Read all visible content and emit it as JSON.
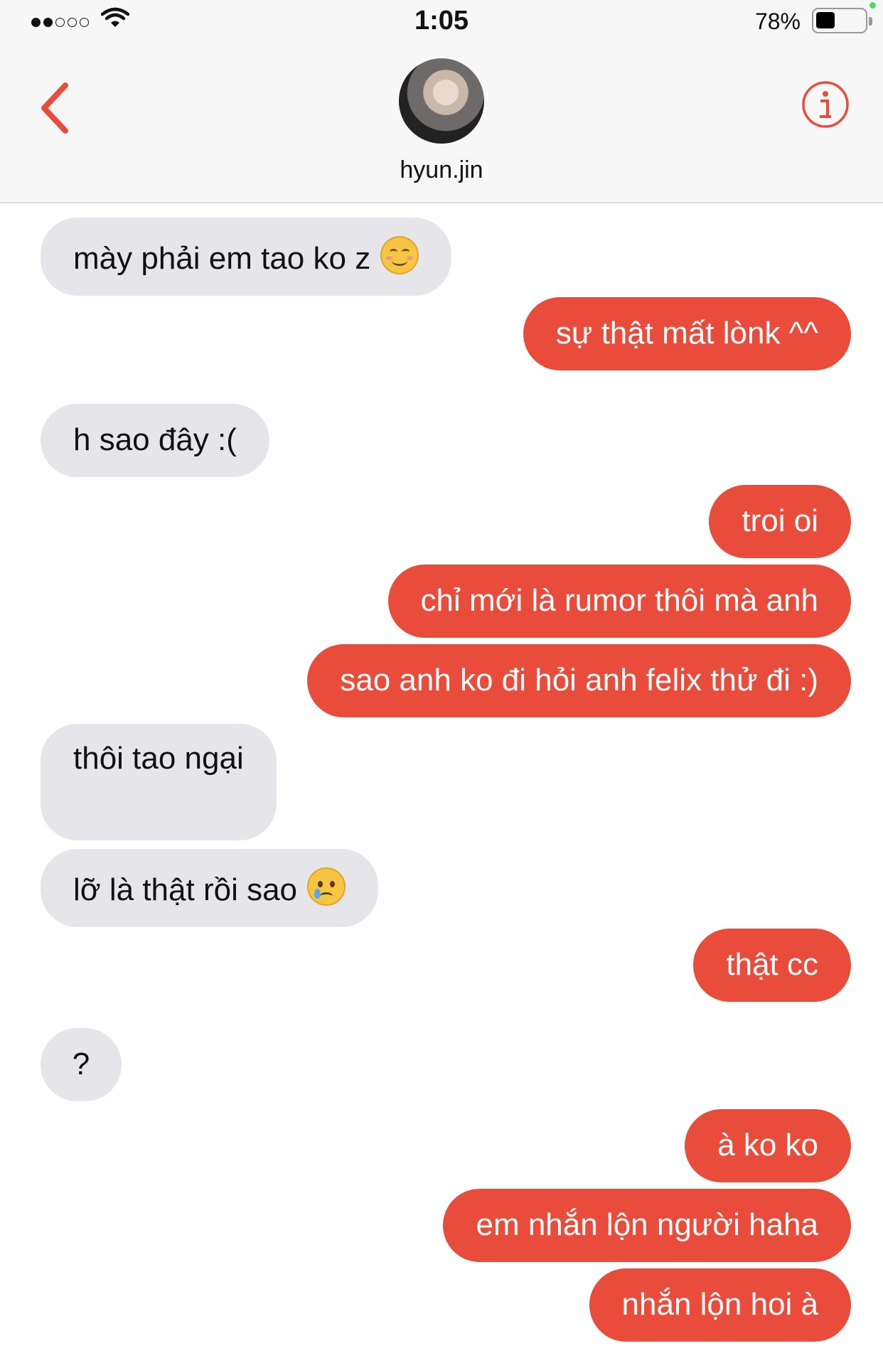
{
  "status_bar": {
    "time": "1:05",
    "battery_percent": "78%",
    "signal_bars_filled": 2,
    "signal_bars_total": 5,
    "wifi": "wifi-icon",
    "battery_level": 0.78
  },
  "header": {
    "contact_name": "hyun.jin",
    "back_icon": "chevron-left-icon",
    "info_icon": "info-icon",
    "accent_color": "#ea4c3c"
  },
  "messages": [
    {
      "from": "them",
      "text": "mày phải em tao ko z",
      "emoji": "smiling-face-icon"
    },
    {
      "from": "me",
      "text": "sự thật mất lònk ^^"
    },
    {
      "from": "them",
      "text": "h sao đây :("
    },
    {
      "from": "me",
      "text": "troi oi"
    },
    {
      "from": "me",
      "text": "chỉ mới là rumor thôi mà anh"
    },
    {
      "from": "me",
      "text": "sao anh ko đi hỏi anh felix thử đi :)"
    },
    {
      "from": "them",
      "text": "thôi tao ngại"
    },
    {
      "from": "them",
      "text": "lỡ là thật rồi sao",
      "emoji": "crying-face-icon"
    },
    {
      "from": "me",
      "text": "thật cc"
    },
    {
      "from": "them",
      "text": "?"
    },
    {
      "from": "me",
      "text": "à ko ko"
    },
    {
      "from": "me",
      "text": "em nhắn lộn người haha"
    },
    {
      "from": "me",
      "text": "nhắn lộn hoi à"
    }
  ],
  "colors": {
    "outgoing_bubble": "#ea4c3c",
    "incoming_bubble": "#e6e6ea"
  }
}
